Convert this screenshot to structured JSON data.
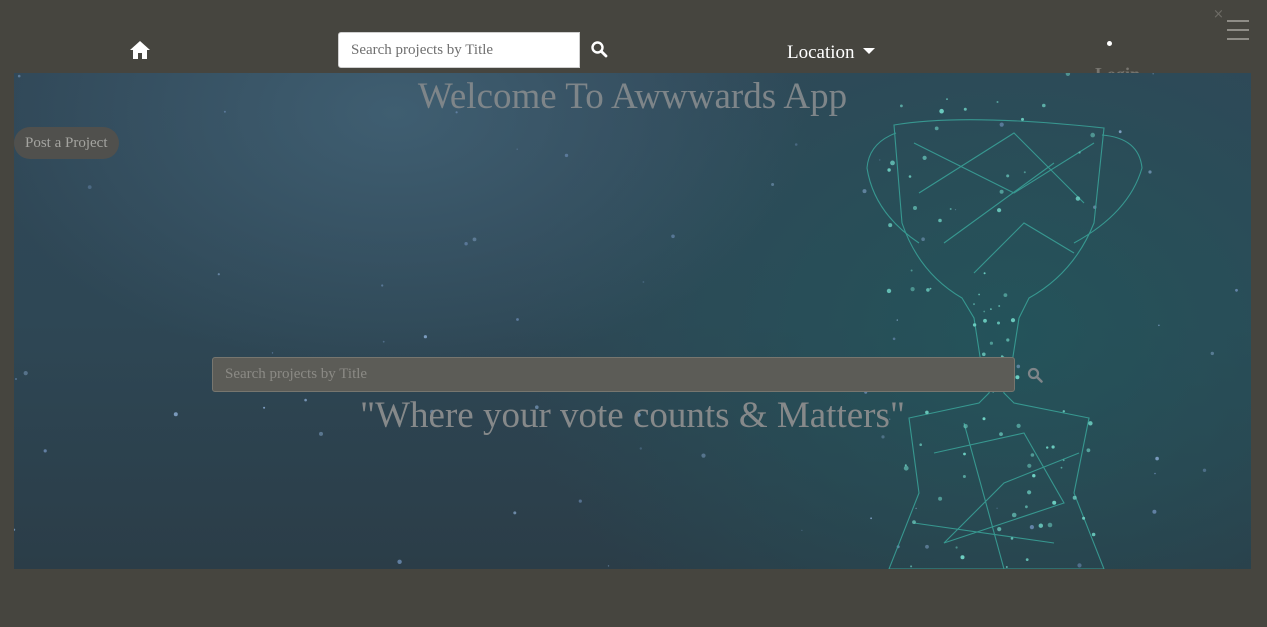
{
  "navbar": {
    "home_icon": "home-icon",
    "search": {
      "placeholder": "Search projects by Title",
      "value": "",
      "button_icon": "search-icon"
    },
    "location_label": "Location",
    "login_label": "Login",
    "close_icon": "close-icon",
    "menu_icon": "hamburger-icon"
  },
  "hero": {
    "title": "Welcome To Awwwards App",
    "post_button_label": "Post a Project",
    "search": {
      "placeholder": "Search projects by Title",
      "value": "",
      "button_icon": "search-icon"
    },
    "tagline": "\"Where your vote counts & Matters\""
  },
  "colors": {
    "page_background": "#46453f",
    "hero_background": "#2f4656",
    "trophy_accent": "#3aa59a",
    "nav_text": "#ffffff"
  }
}
